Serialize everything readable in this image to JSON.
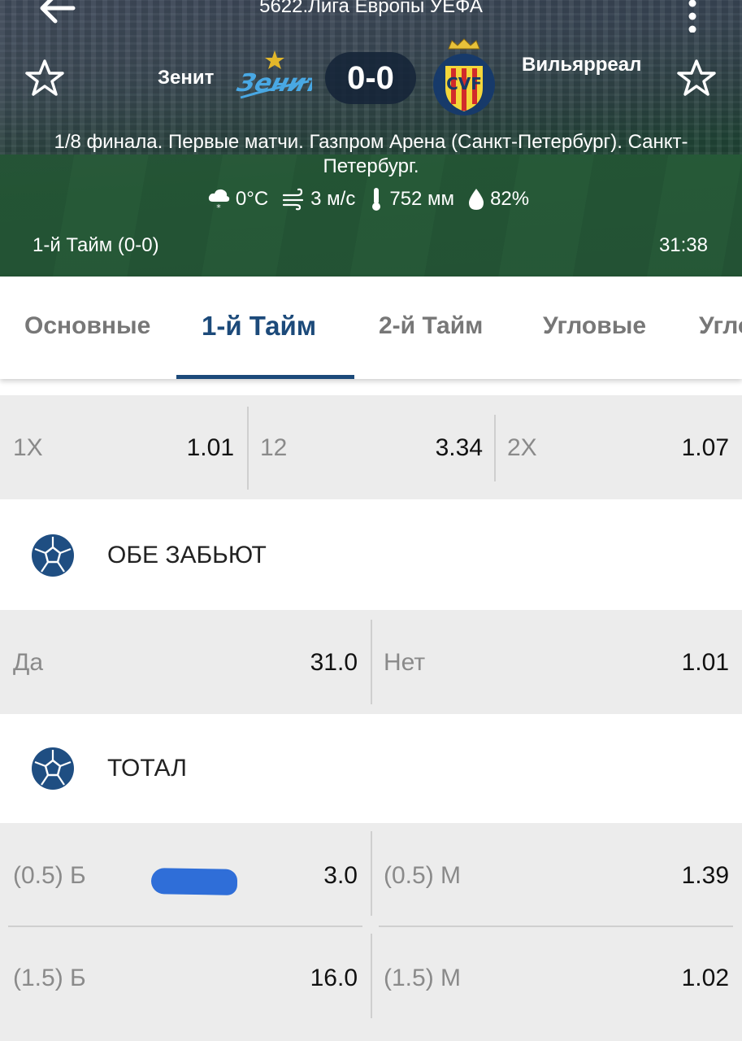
{
  "header": {
    "league": "5622.Лига Европы УЕФА",
    "home_team": "Зенит",
    "away_team": "Вильярреал",
    "score": "0-0",
    "match_info": "1/8 финала. Первые матчи. Газпром Арена (Санкт-Петербург). Санкт-Петербург.",
    "weather": {
      "temperature": "0°C",
      "wind": "3 м/с",
      "pressure": "752 мм",
      "humidity": "82%"
    },
    "period": "1-й  Тайм (0-0)",
    "clock": "31:38"
  },
  "tabs": [
    {
      "label": "Основные",
      "active": false
    },
    {
      "label": "1-й  Тайм",
      "active": true
    },
    {
      "label": "2-й  Тайм",
      "active": false
    },
    {
      "label": "Угловые",
      "active": false
    },
    {
      "label": "Угловые",
      "active": false
    }
  ],
  "markets": {
    "double_chance": [
      {
        "label": "1X",
        "odds": "1.01"
      },
      {
        "label": "12",
        "odds": "3.34"
      },
      {
        "label": "2X",
        "odds": "1.07"
      }
    ],
    "both_score": {
      "title": "ОБЕ ЗАБЬЮТ",
      "options": [
        {
          "label": "Да",
          "odds": "31.0"
        },
        {
          "label": "Нет",
          "odds": "1.01"
        }
      ]
    },
    "total": {
      "title": "ТОТАЛ",
      "rows": [
        {
          "over_label": "(0.5) Б",
          "over_odds": "3.0",
          "under_label": "(0.5) М",
          "under_odds": "1.39"
        },
        {
          "over_label": "(1.5) Б",
          "over_odds": "16.0",
          "under_label": "(1.5) М",
          "under_odds": "1.02"
        }
      ]
    }
  },
  "colors": {
    "accent": "#1c4a7a",
    "row_bg": "#ececec",
    "marker": "#2f6ed8"
  },
  "icons": {
    "back": "arrow-left-icon",
    "more": "more-vertical-icon",
    "favorite": "star-outline-icon",
    "section": "soccer-ball-icon"
  }
}
